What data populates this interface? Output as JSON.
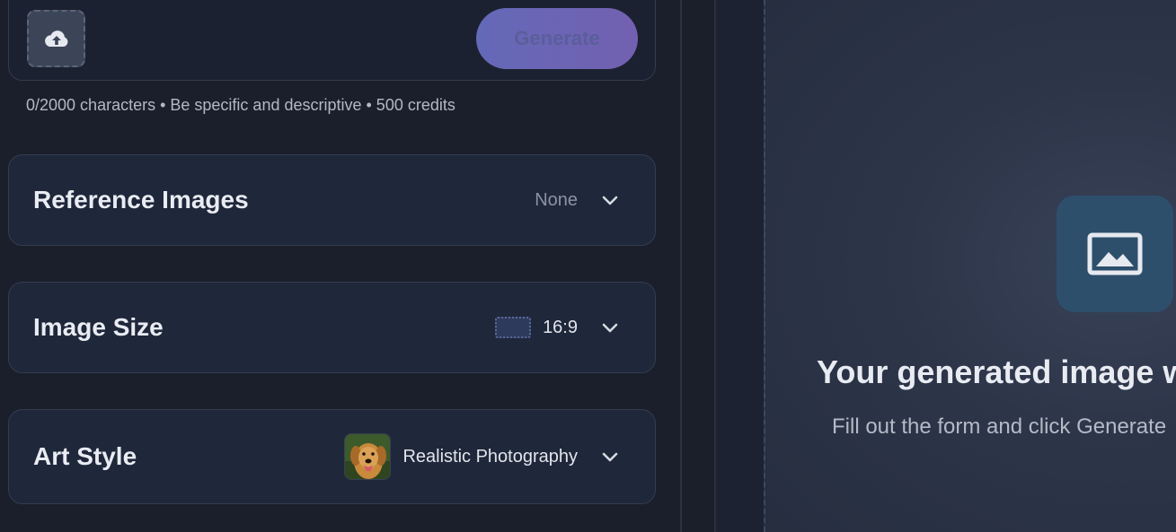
{
  "prompt": {
    "upload_icon": "cloud-upload-icon",
    "generate_label": "Generate",
    "helper_text": "0/2000 characters • Be specific and descriptive • 500 credits"
  },
  "sections": {
    "reference_images": {
      "title": "Reference Images",
      "value": "None",
      "icon": "chevron-down-icon"
    },
    "image_size": {
      "title": "Image Size",
      "value": "16:9",
      "icon": "chevron-down-icon"
    },
    "art_style": {
      "title": "Art Style",
      "value": "Realistic Photography",
      "thumbnail": "golden-retriever-photo",
      "icon": "chevron-down-icon"
    }
  },
  "preview": {
    "icon": "image-icon",
    "heading": "Your generated image w",
    "subtext": "Fill out the form and click Generate"
  },
  "colors": {
    "background": "#1a1f2b",
    "card": "#1f273a",
    "accent_gradient_start": "#6469b8",
    "accent_gradient_end": "#7360b0",
    "placeholder_tile": "#2e4f6c"
  }
}
